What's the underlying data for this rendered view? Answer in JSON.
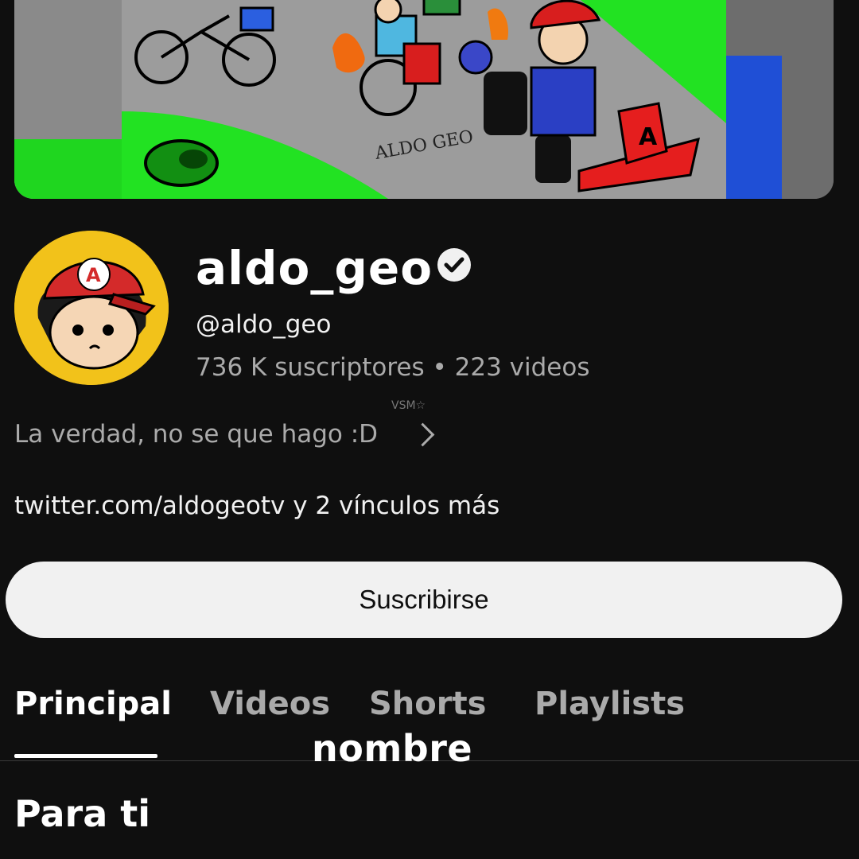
{
  "banner": {
    "artwork_signature": "ALDO GEO"
  },
  "channel": {
    "name": "aldo_geo",
    "handle": "@aldo_geo",
    "stats": "736 K suscriptores • 223 videos",
    "description": "La verdad, no se que hago :D",
    "links": "twitter.com/aldogeotv y 2 vínculos más",
    "avatar_letter": "A"
  },
  "watermark": "VSM☆",
  "buttons": {
    "subscribe": "Suscribirse"
  },
  "tabs": [
    {
      "label": "Principal",
      "active": true
    },
    {
      "label": "Videos",
      "active": false
    },
    {
      "label": "Shorts",
      "active": false
    },
    {
      "label": "Playlists",
      "active": false
    }
  ],
  "overlay_caption": "nombre",
  "section": {
    "title": "Para ti"
  },
  "icons": {
    "verified": "check-circle-icon",
    "chevron": "chevron-right-icon"
  },
  "colors": {
    "background": "#0f0f0f",
    "subscribe_bg": "#f1f1f1",
    "muted_text": "#aaaaaa",
    "avatar_yellow": "#f2c21a",
    "cap_red": "#d42a2a"
  }
}
